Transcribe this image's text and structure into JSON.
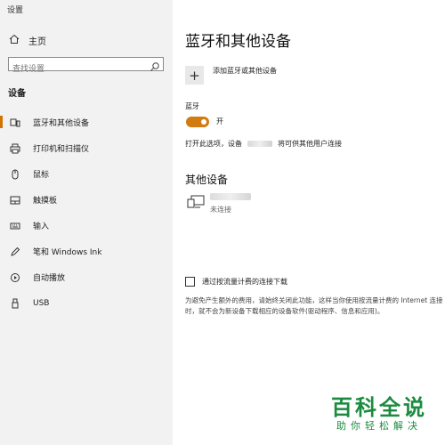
{
  "window": {
    "title": "设置"
  },
  "sidebar": {
    "home_label": "主页",
    "search_placeholder": "查找设置",
    "section_header": "设备",
    "items": [
      {
        "label": "蓝牙和其他设备",
        "icon": "bluetooth-devices-icon",
        "active": true
      },
      {
        "label": "打印机和扫描仪",
        "icon": "printer-icon",
        "active": false
      },
      {
        "label": "鼠标",
        "icon": "mouse-icon",
        "active": false
      },
      {
        "label": "触摸板",
        "icon": "touchpad-icon",
        "active": false
      },
      {
        "label": "输入",
        "icon": "keyboard-icon",
        "active": false
      },
      {
        "label": "笔和 Windows Ink",
        "icon": "pen-icon",
        "active": false
      },
      {
        "label": "自动播放",
        "icon": "autoplay-icon",
        "active": false
      },
      {
        "label": "USB",
        "icon": "usb-icon",
        "active": false
      }
    ]
  },
  "main": {
    "title": "蓝牙和其他设备",
    "add_device_label": "添加蓝牙或其他设备",
    "bluetooth_label": "蓝牙",
    "bluetooth_state": "开",
    "discoverable_text_before": "打开此选项，设备",
    "discoverable_text_after": "将可供其他用户连接",
    "other_devices_title": "其他设备",
    "device_status": "未连接",
    "metered_label": "通过按流量计费的连接下载",
    "metered_description": "为避免产生额外的费用，请始终关闭此功能，这样当你使用按流量计费的 Internet 连接时，就不会为新设备下载相应的设备软件(驱动程序、信息和应用)。"
  },
  "watermark": {
    "main": "百科全说",
    "sub": "助你轻松解决"
  },
  "colors": {
    "accent": "#d27b0f",
    "watermark": "#1b8b3f"
  }
}
